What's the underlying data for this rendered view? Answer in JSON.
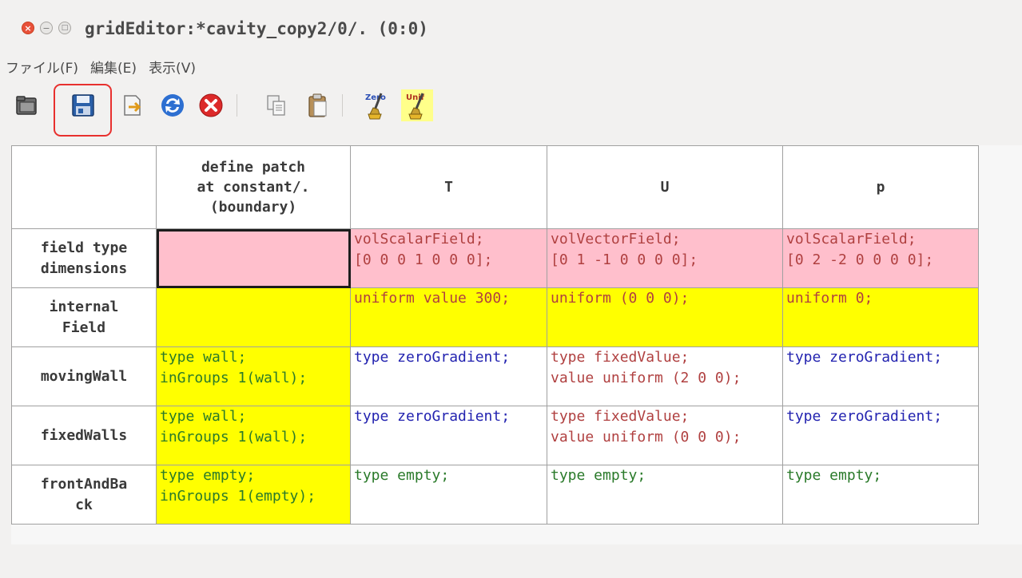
{
  "window": {
    "title": "gridEditor:*cavity_copy2/0/. (0:0)",
    "controls": {
      "close": "×",
      "minimize": "−",
      "maximize": "□"
    }
  },
  "menu": {
    "items": [
      "ファイル(F)",
      "編集(E)",
      "表示(V)"
    ]
  },
  "toolbar": {
    "buttons": [
      {
        "name": "open-folder-icon"
      },
      {
        "name": "save-icon"
      },
      {
        "name": "export-icon"
      },
      {
        "name": "reload-icon"
      },
      {
        "name": "cancel-icon"
      },
      {
        "name": "copy-icon"
      },
      {
        "name": "paste-icon"
      },
      {
        "name": "zero-icon",
        "label": "Zero"
      },
      {
        "name": "unif-icon",
        "label": "Unif"
      }
    ]
  },
  "grid": {
    "columns": [
      "define patch\nat constant/.\n(boundary)",
      "T",
      "U",
      "p"
    ],
    "rows": [
      {
        "header": "field type\ndimensions",
        "cells": [
          {
            "text": "",
            "bg": "pink",
            "color": "red"
          },
          {
            "text": "volScalarField;\n[0 0 0 1 0 0 0];",
            "bg": "pink",
            "color": "red"
          },
          {
            "text": "volVectorField;\n[0 1 -1 0 0 0 0];",
            "bg": "pink",
            "color": "red"
          },
          {
            "text": "volScalarField;\n[0 2 -2 0 0 0 0];",
            "bg": "pink",
            "color": "red"
          }
        ]
      },
      {
        "header": "internal\nField",
        "cells": [
          {
            "text": "",
            "bg": "yellow",
            "color": "red"
          },
          {
            "text": "uniform value 300;",
            "bg": "yellow",
            "color": "red"
          },
          {
            "text": "uniform (0 0 0);",
            "bg": "yellow",
            "color": "red"
          },
          {
            "text": "uniform 0;",
            "bg": "yellow",
            "color": "red"
          }
        ]
      },
      {
        "header": "movingWall",
        "cells": [
          {
            "text": "type wall;\ninGroups 1(wall);",
            "bg": "yellow",
            "color": "green"
          },
          {
            "text": "type zeroGradient;",
            "bg": "white",
            "color": "blue"
          },
          {
            "text": "type fixedValue;\nvalue uniform (2 0 0);",
            "bg": "white",
            "color": "red"
          },
          {
            "text": "type zeroGradient;",
            "bg": "white",
            "color": "blue"
          }
        ]
      },
      {
        "header": "fixedWalls",
        "cells": [
          {
            "text": "type wall;\ninGroups 1(wall);",
            "bg": "yellow",
            "color": "green"
          },
          {
            "text": "type zeroGradient;",
            "bg": "white",
            "color": "blue"
          },
          {
            "text": "type fixedValue;\nvalue uniform (0 0 0);",
            "bg": "white",
            "color": "red"
          },
          {
            "text": "type zeroGradient;",
            "bg": "white",
            "color": "blue"
          }
        ]
      },
      {
        "header": "frontAndBa\nck",
        "cells": [
          {
            "text": "type empty;\ninGroups 1(empty);",
            "bg": "yellow",
            "color": "green"
          },
          {
            "text": "type empty;",
            "bg": "white",
            "color": "green"
          },
          {
            "text": "type empty;",
            "bg": "white",
            "color": "green"
          },
          {
            "text": "type empty;",
            "bg": "white",
            "color": "green"
          }
        ]
      }
    ]
  },
  "colors": {
    "pink_cell": "#ffbfcc",
    "yellow_cell": "#ffff00",
    "text_red": "#b04040",
    "text_blue": "#2323b0",
    "text_green": "#2a7a2a",
    "save_highlight": "#e8302e"
  }
}
